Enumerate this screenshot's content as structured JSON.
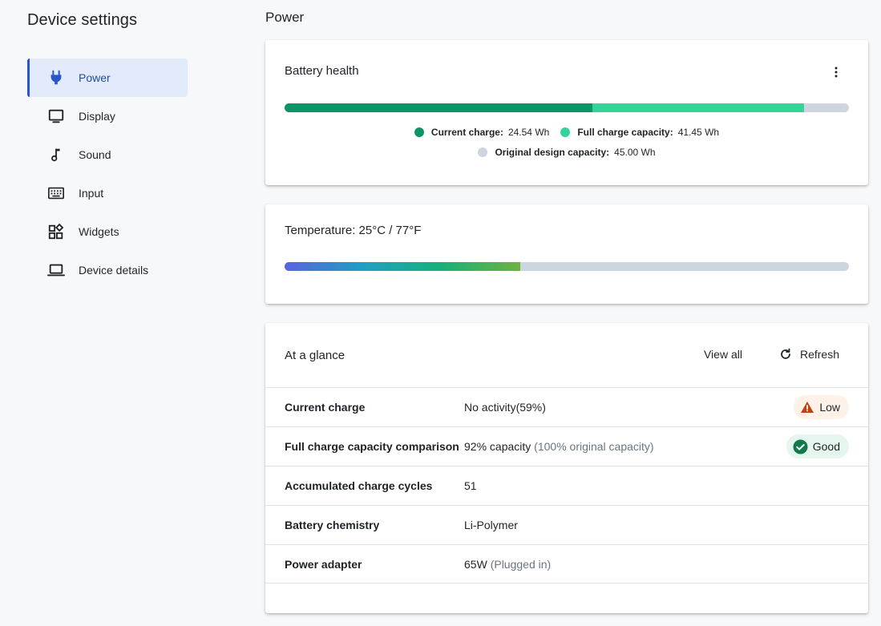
{
  "sidebar": {
    "title": "Device settings",
    "items": [
      {
        "label": "Power",
        "icon": "plug-icon",
        "active": true
      },
      {
        "label": "Display",
        "icon": "monitor-icon"
      },
      {
        "label": "Sound",
        "icon": "music-note-icon"
      },
      {
        "label": "Input",
        "icon": "keyboard-icon"
      },
      {
        "label": "Widgets",
        "icon": "widgets-icon"
      },
      {
        "label": "Device details",
        "icon": "laptop-icon"
      }
    ]
  },
  "page": {
    "title": "Power"
  },
  "battery": {
    "title": "Battery health",
    "current_charge_wh": 24.54,
    "full_capacity_wh": 41.45,
    "design_capacity_wh": 45.0,
    "legend": {
      "current_label": "Current charge:",
      "current_value": "24.54 Wh",
      "full_label": "Full charge capacity:",
      "full_value": "41.45 Wh",
      "design_label": "Original design capacity:",
      "design_value": "45.00 Wh"
    }
  },
  "temperature": {
    "title": "Temperature:  25°C / 77°F",
    "level_fraction": 0.417
  },
  "glance": {
    "title": "At a glance",
    "view_all": "View all",
    "refresh": "Refresh",
    "rows": [
      {
        "label": "Current charge",
        "value": "No activity(59%)",
        "sub": "",
        "badge": "Low",
        "badge_type": "warning"
      },
      {
        "label": "Full charge capacity comparison",
        "value": "92% capacity",
        "sub": "(100% original capacity)",
        "badge": "Good",
        "badge_type": "success"
      },
      {
        "label": "Accumulated charge cycles",
        "value": "51",
        "sub": ""
      },
      {
        "label": "Battery chemistry",
        "value": "Li-Polymer",
        "sub": ""
      },
      {
        "label": "Power adapter",
        "value": "65W",
        "sub": "(Plugged in)"
      }
    ]
  },
  "colors": {
    "accent": "#2a57c8",
    "current_charge": "#0f9468",
    "full_capacity": "#36d399",
    "design_capacity": "#cdd5df",
    "warning": "#c2410c",
    "success": "#117a4a"
  }
}
